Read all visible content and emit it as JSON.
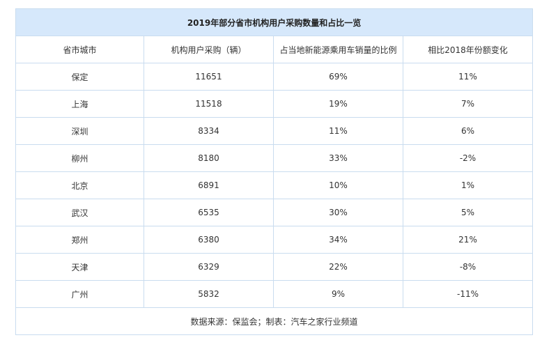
{
  "table": {
    "title": "2019年部分省市机构用户采购数量和占比一览",
    "headers": [
      "省市城市",
      "机构用户采购（辆）",
      "占当地新能源乘用车销量的比例",
      "相比2018年份额变化"
    ],
    "rows": [
      [
        "保定",
        "11651",
        "69%",
        "11%"
      ],
      [
        "上海",
        "11518",
        "19%",
        "7%"
      ],
      [
        "深圳",
        "8334",
        "11%",
        "6%"
      ],
      [
        "柳州",
        "8180",
        "33%",
        "-2%"
      ],
      [
        "北京",
        "6891",
        "10%",
        "1%"
      ],
      [
        "武汉",
        "6535",
        "30%",
        "5%"
      ],
      [
        "郑州",
        "6380",
        "34%",
        "21%"
      ],
      [
        "天津",
        "6329",
        "22%",
        "-8%"
      ],
      [
        "广州",
        "5832",
        "9%",
        "-11%"
      ]
    ],
    "footer": "数据来源：保监会；制表：汽车之家行业频道"
  },
  "colors": {
    "title_background": "#d6e8fb",
    "border": "#c9dcef"
  }
}
